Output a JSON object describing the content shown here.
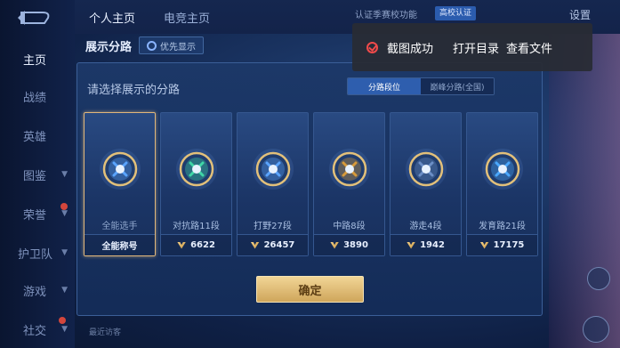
{
  "nav": {
    "tabs": [
      "个人主页",
      "电竞主页"
    ],
    "verify_text": "认证季赛校功能",
    "school_badge": "高校认证",
    "settings": "设置"
  },
  "sidebar": {
    "items": [
      {
        "label": "主页",
        "active": true
      },
      {
        "label": "战绩"
      },
      {
        "label": "英雄"
      },
      {
        "label": "图鉴"
      },
      {
        "label": "荣誉"
      },
      {
        "label": "护卫队"
      },
      {
        "label": "游戏"
      },
      {
        "label": "社交"
      }
    ]
  },
  "panel": {
    "title": "展示分路",
    "priority": "优先显示",
    "prompt": "请选择展示的分路",
    "segment": [
      "分路段位",
      "巅峰分路(全国)"
    ],
    "confirm": "确定"
  },
  "cards": [
    {
      "label": "全能选手",
      "foot": "全能称号",
      "selected": true,
      "emblem": "all-round-emblem-icon",
      "accent": "#5aa4ff"
    },
    {
      "label": "对抗路11段",
      "foot": "6622",
      "emblem": "clash-lane-emblem-icon",
      "accent": "#3fd6a6"
    },
    {
      "label": "打野27段",
      "foot": "26457",
      "emblem": "jungle-emblem-icon",
      "accent": "#5aa4ff"
    },
    {
      "label": "中路8段",
      "foot": "3890",
      "emblem": "mid-lane-emblem-icon",
      "accent": "#d79a3a"
    },
    {
      "label": "游走4段",
      "foot": "1942",
      "emblem": "roam-emblem-icon",
      "accent": "#6b8ec6"
    },
    {
      "label": "发育路21段",
      "foot": "17175",
      "emblem": "farm-lane-emblem-icon",
      "accent": "#4aa8ff"
    }
  ],
  "toast": {
    "message": "截图成功",
    "open_dir": "打开目录",
    "view_file": "查看文件"
  },
  "bottom_hint": "最近访客"
}
